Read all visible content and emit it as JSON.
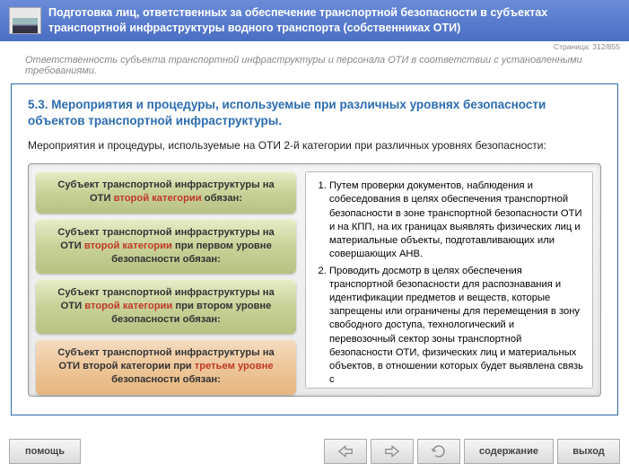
{
  "header": {
    "title": "Подготовка лиц, ответственных за обеспечение транспортной безопасности в субъектах транспортной инфраструктуры водного транспорта (собственниках ОТИ)"
  },
  "page_indicator": "Страница: 312/855",
  "subtitle": "Ответственность субъекта транспортной инфраструктуры и персонала ОТИ в соответствии с установленными требованиями.",
  "section_title": "5.3. Мероприятия и процедуры, используемые при различных уровнях безопасности объектов транспортной инфраструктуры.",
  "intro": "Мероприятия и процедуры, используемые на ОТИ 2-й категории при различных уровнях безопасности:",
  "pills": {
    "p1_a": "Субъект транспортной инфраструктуры на ОТИ ",
    "p1_b": "второй категории",
    "p1_c": " обязан:",
    "p2_a": "Субъект транспортной инфраструктуры на ОТИ ",
    "p2_b": "второй категории",
    "p2_c": " при первом уровне безопасности обязан:",
    "p3_a": "Субъект транспортной инфраструктуры на ОТИ ",
    "p3_b": "второй категории",
    "p3_c": " при втором уровне безопасности обязан:",
    "p4_a": "Субъект транспортной инфраструктуры на ОТИ второй категории при ",
    "p4_b": "третьем уровне",
    "p4_c": " безопасности обязан:"
  },
  "list": {
    "i1": "Путем проверки документов, наблюдения и собеседования в целях обеспечения транспортной безопасности в зоне транспортной безопасности ОТИ и на КПП, на их границах выявлять физических лиц и материальные объекты, подготавливающих или совершающих АНВ.",
    "i2": "Проводить досмотр в целях обеспечения транспортной безопасности для распознавания и идентификации предметов и веществ, которые запрещены или ограничены для перемещения в зону свободного доступа, технологический и перевозочный сектор зоны транспортной безопасности ОТИ, физических лиц и материальных объектов, в отношении которых будет выявлена связь с"
  },
  "footer": {
    "help": "помощь",
    "content": "содержание",
    "exit": "выход"
  }
}
